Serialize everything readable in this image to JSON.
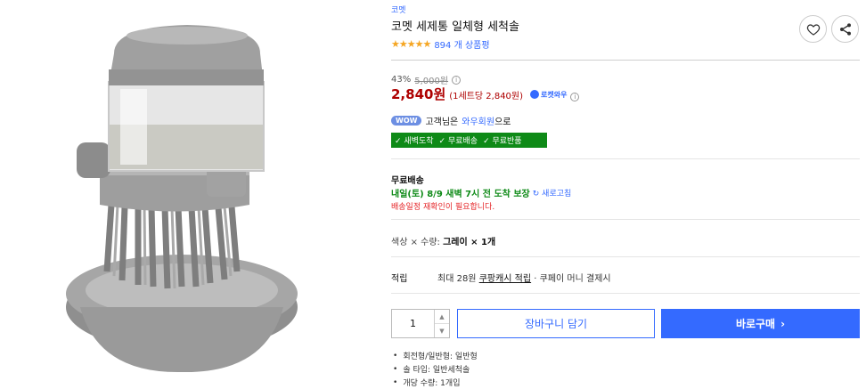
{
  "product": {
    "brand": "코멧",
    "title": "코멧 세제통 일체형 세척솔",
    "rating_stars": "★★★★★",
    "review_count": "894 개 상품평"
  },
  "pricing": {
    "discount_rate": "43%",
    "original_price": "5,000원",
    "price": "2,840원",
    "unit_price": "(1세트당 2,840원)",
    "rocket_label": "로켓와우"
  },
  "wow": {
    "badge": "WOW",
    "text_before": "고객님은",
    "link": "와우회원",
    "text_after": "으로"
  },
  "benefits": [
    "새벽도착",
    "무료배송",
    "무료반품"
  ],
  "shipping": {
    "label": "무료배송",
    "date_text": "내일(토) 8/9 새벽 7시 전 도착 보장",
    "refresh_label": "새로고침",
    "warning": "배송일정 재확인이 필요합니다."
  },
  "option": {
    "text": "색상 × 수량:",
    "value": "그레이 × 1개"
  },
  "points": {
    "label": "적립",
    "prefix": "최대 28원",
    "cash_link": "쿠팡캐시 적립",
    "suffix": "· 쿠페이 머니 결제시"
  },
  "purchase": {
    "quantity": "1",
    "cart_label": "장바구니 담기",
    "buy_label": "바로구매",
    "buy_arrow": "›"
  },
  "attributes": [
    "회전형/일반형: 일반형",
    "솔 타입: 일반세척솔",
    "개당 수량: 1개입"
  ],
  "icons": {
    "favorite": "heart-icon",
    "share": "share-icon",
    "info": "info-icon",
    "check": "check-icon"
  },
  "colors": {
    "accent": "#346aff",
    "price": "#ae0000",
    "benefit_green": "#0e8a17",
    "warning": "#e52528",
    "star": "#f5a623"
  }
}
